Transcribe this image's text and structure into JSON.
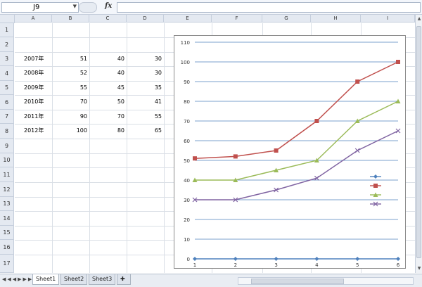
{
  "formula_bar": {
    "name_box": "J9",
    "fx_label": "fx",
    "formula": ""
  },
  "columns": [
    "A",
    "B",
    "C",
    "D",
    "E",
    "F",
    "G",
    "H",
    "I"
  ],
  "rows": [
    "1",
    "2",
    "3",
    "4",
    "5",
    "6",
    "7",
    "8",
    "9",
    "10",
    "11",
    "12",
    "13",
    "14",
    "15",
    "16",
    "17"
  ],
  "table": [
    {
      "year": "2007年",
      "b": "51",
      "c": "40",
      "d": "30"
    },
    {
      "year": "2008年",
      "b": "52",
      "c": "40",
      "d": "30"
    },
    {
      "year": "2009年",
      "b": "55",
      "c": "45",
      "d": "35"
    },
    {
      "year": "2010年",
      "b": "70",
      "c": "50",
      "d": "41"
    },
    {
      "year": "2011年",
      "b": "90",
      "c": "70",
      "d": "55"
    },
    {
      "year": "2012年",
      "b": "100",
      "c": "80",
      "d": "65"
    }
  ],
  "sheet_tabs": [
    "Sheet1",
    "Sheet2",
    "Sheet3"
  ],
  "colors": {
    "series1": "#4f81bd",
    "series2": "#c0504d",
    "series3": "#9bbb59",
    "series4": "#8064a2",
    "gridline": "#4f81bd"
  },
  "chart_data": {
    "type": "line",
    "x": [
      1,
      2,
      3,
      4,
      5,
      6
    ],
    "x_tick_labels": [
      "1",
      "2",
      "3",
      "4",
      "5",
      "6"
    ],
    "ylim": [
      0,
      110
    ],
    "y_ticks": [
      0,
      10,
      20,
      30,
      40,
      50,
      60,
      70,
      80,
      90,
      100,
      110
    ],
    "grid": true,
    "legend": "right, no text labels",
    "series": [
      {
        "values": [
          0,
          0,
          0,
          0,
          0,
          0
        ],
        "marker": "diamond",
        "color": "#4f81bd"
      },
      {
        "values": [
          51,
          52,
          55,
          70,
          90,
          100
        ],
        "marker": "square",
        "color": "#c0504d"
      },
      {
        "values": [
          40,
          40,
          45,
          50,
          70,
          80
        ],
        "marker": "triangle",
        "color": "#9bbb59"
      },
      {
        "values": [
          30,
          30,
          35,
          41,
          55,
          65
        ],
        "marker": "x",
        "color": "#8064a2"
      }
    ]
  }
}
